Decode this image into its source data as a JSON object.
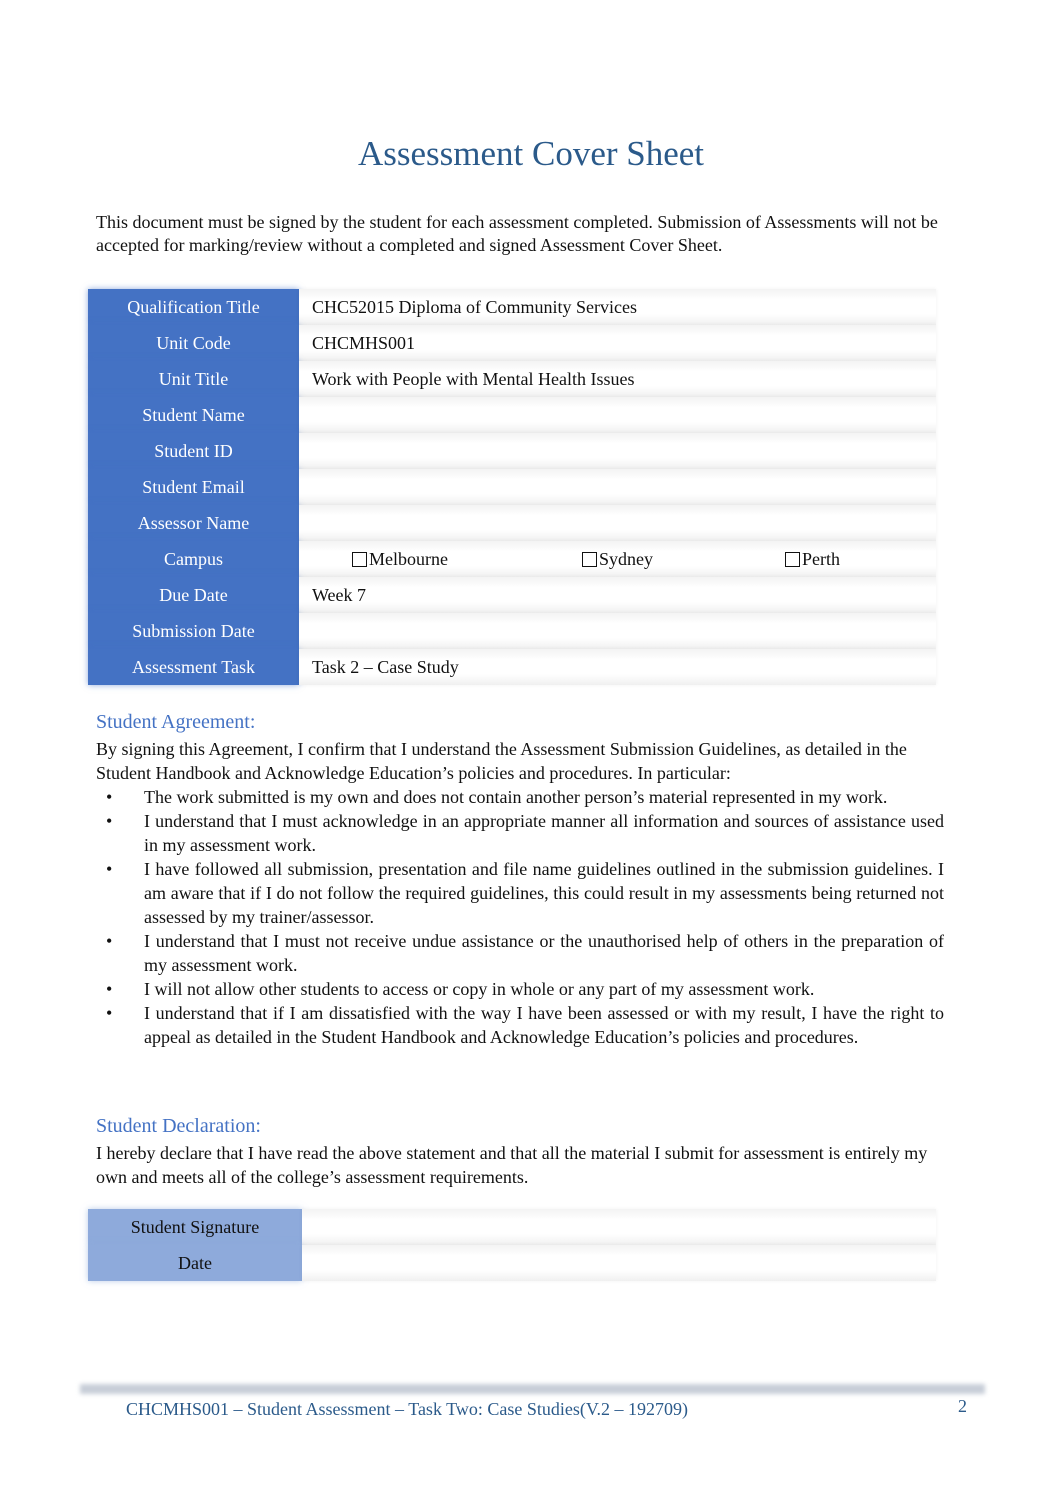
{
  "document": {
    "title": "Assessment Cover Sheet",
    "intro": "This document must be signed by the student for each assessment completed. Submission of Assessments will not be accepted for marking/review without a completed and signed Assessment Cover Sheet."
  },
  "cover_table": {
    "rows": [
      {
        "label": "Qualification Title",
        "value": "CHC52015 Diploma of Community Services"
      },
      {
        "label": "Unit Code",
        "value": "CHCMHS001"
      },
      {
        "label": "Unit Title",
        "value": "Work with People with Mental Health Issues"
      },
      {
        "label": "Student Name",
        "value": ""
      },
      {
        "label": "Student ID",
        "value": ""
      },
      {
        "label": "Student Email",
        "value": ""
      },
      {
        "label": "Assessor Name",
        "value": ""
      },
      {
        "label": "Campus",
        "value": ""
      },
      {
        "label": "Due Date",
        "value": "Week 7"
      },
      {
        "label": "Submission Date",
        "value": ""
      },
      {
        "label": "Assessment Task",
        "value": "Task 2 – Case Study"
      }
    ],
    "campus_options": [
      {
        "label": "Melbourne",
        "checked": false
      },
      {
        "label": "Sydney",
        "checked": false
      },
      {
        "label": "Perth",
        "checked": false
      }
    ]
  },
  "agreement": {
    "heading": "Student Agreement:",
    "intro": "By signing this Agreement, I confirm that I understand the Assessment Submission Guidelines, as detailed in the Student Handbook and Acknowledge Education’s policies and procedures. In particular:",
    "bullet_char": "•",
    "items": [
      "The work submitted is my own and does not contain another person’s material represented in my work.",
      "I understand that I must acknowledge in an appropriate manner all information and sources of assistance used in my assessment work.",
      "I have followed all submission, presentation and file name guidelines outlined in the submission guidelines. I am aware that if I do not follow the required guidelines, this could result in my assessments being returned not assessed by my trainer/assessor.",
      "I understand that I must not receive undue assistance or the unauthorised help of others in the preparation of my assessment work.",
      "I will not allow other students to access or copy in whole or any part of my assessment work.",
      "I understand that if I am dissatisfied with the way I have been assessed or with my result, I have the right to appeal as detailed in the Student Handbook and Acknowledge Education’s policies and procedures."
    ]
  },
  "declaration": {
    "heading": "Student Declaration:",
    "text": "I hereby declare that I have read the above statement and that all the material I submit for assessment is entirely my own and meets all of the college’s assessment requirements."
  },
  "signature_table": {
    "rows": [
      {
        "label": "Student Signature",
        "value": ""
      },
      {
        "label": "Date",
        "value": ""
      }
    ]
  },
  "footer": {
    "text": "CHCMHS001 – Student Assessment – Task Two: Case Studies(V.2 – 192709)",
    "page_number": "2"
  }
}
